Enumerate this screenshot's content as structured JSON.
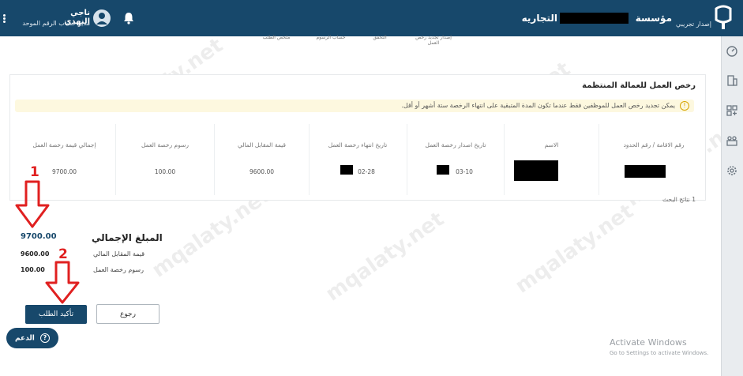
{
  "header": {
    "version_label": "إصدار تجريبي",
    "establishment_prefix": "مؤسسة",
    "establishment_suffix": "التجاريه",
    "user_name": "ناجي النهدي",
    "user_role": "مدير حساب الرقم الموحد"
  },
  "steps": [
    "ملخص الطلب",
    "حساب الرسوم",
    "التحقق",
    "إصدار تجديد رخص العمل"
  ],
  "card": {
    "title": "رخص العمل للعمالة المنتظمة",
    "alert_text": "يمكن تجديد رخص العمل للموظفين فقط عندما تكون المدة المتبقية على انتهاء الرخصة ستة أشهر أو أقل."
  },
  "table": {
    "headers": [
      "رقم الاقامة / رقم الحدود",
      "الاسم",
      "تاريخ اصدار رخصة العمل",
      "تاريخ انتهاء رخصة العمل",
      "قيمة المقابل المالي",
      "رسوم رخصة العمل",
      "إجمالي قيمة رخصة العمل"
    ],
    "row": {
      "issue_date_fragment": "03-10",
      "expiry_date_fragment": "02-28",
      "financial_value": "9600.00",
      "license_fee": "100.00",
      "total": "9700.00"
    }
  },
  "results_count": "1 نتائج البحث",
  "summary": {
    "title": "المبلغ الإجمالي",
    "total": "9700.00",
    "financial_label": "قيمة المقابل المالي",
    "financial_value": "9600.00",
    "fee_label": "رسوم رخصة العمل",
    "fee_value": "100.00"
  },
  "annotations": {
    "step1": "1",
    "step2": "2"
  },
  "buttons": {
    "confirm": "تأكيد الطلب",
    "back": "رجوع",
    "support": "الدعم"
  },
  "watermark": "mqalaty.net",
  "windows_activation": {
    "title": "Activate Windows",
    "subtitle": "Go to Settings to activate Windows."
  },
  "colors": {
    "primary": "#17486b",
    "alert_bg": "#fdf8df",
    "annotation_red": "#e02020"
  }
}
